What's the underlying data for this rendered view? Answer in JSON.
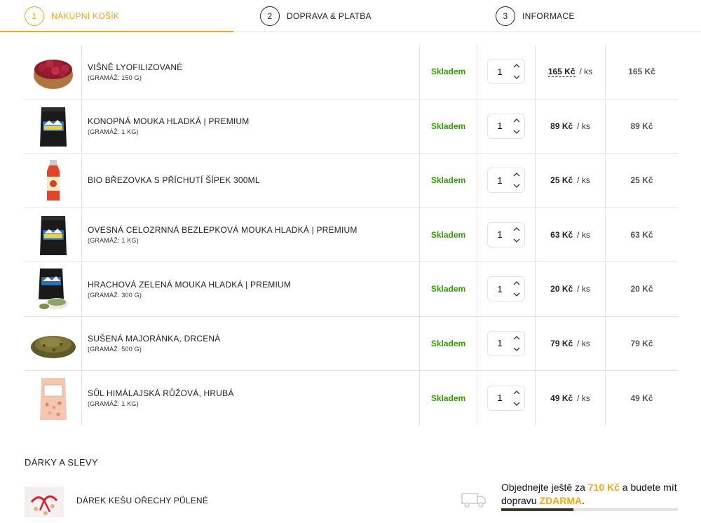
{
  "steps": [
    {
      "num": "1",
      "label": "NÁKUPNÍ KOŠÍK",
      "active": true
    },
    {
      "num": "2",
      "label": "DOPRAVA & PLATBA",
      "active": false
    },
    {
      "num": "3",
      "label": "INFORMACE",
      "active": false
    }
  ],
  "cart": {
    "items": [
      {
        "name": "VIŠNĚ LYOFILIZOVANÉ",
        "variant": "(GRAMÁŽ: 150 G)",
        "stock": "Skladem",
        "qty": "1",
        "price": "165 Kč",
        "unit": "/ ks",
        "total": "165 Kč",
        "image": "cherries-bowl"
      },
      {
        "name": "KONOPNÁ MOUKA HLADKÁ | PREMIUM",
        "variant": "(GRAMÁŽ: 1 KG)",
        "stock": "Skladem",
        "qty": "1",
        "price": "89 Kč",
        "unit": "/ ks",
        "total": "89 Kč",
        "image": "black-bag"
      },
      {
        "name": "BIO BŘEZOVKA S PŘÍCHUTÍ ŠÍPEK 300ML",
        "variant": "",
        "stock": "Skladem",
        "qty": "1",
        "price": "25 Kč",
        "unit": "/ ks",
        "total": "25 Kč",
        "image": "juice-bottle"
      },
      {
        "name": "OVESNÁ CELOZRNNÁ BEZLEPKOVÁ MOUKA HLADKÁ | PREMIUM",
        "variant": "(GRAMÁŽ: 1 KG)",
        "stock": "Skladem",
        "qty": "1",
        "price": "63 Kč",
        "unit": "/ ks",
        "total": "63 Kč",
        "image": "black-bag"
      },
      {
        "name": "HRACHOVÁ ZELENÁ MOUKA HLADKÁ | PREMIUM",
        "variant": "(GRAMÁŽ: 300 G)",
        "stock": "Skladem",
        "qty": "1",
        "price": "20 Kč",
        "unit": "/ ks",
        "total": "20 Kč",
        "image": "small-bag"
      },
      {
        "name": "SUŠENÁ MAJORÁNKA, DRCENÁ",
        "variant": "(GRAMÁŽ: 500 G)",
        "stock": "Skladem",
        "qty": "1",
        "price": "79 Kč",
        "unit": "/ ks",
        "total": "79 Kč",
        "image": "herb-pile"
      },
      {
        "name": "SŮL HIMÁLAJSKÁ RŮŽOVÁ, HRUBÁ",
        "variant": "(GRAMÁŽ: 1 KG)",
        "stock": "Skladem",
        "qty": "1",
        "price": "49 Kč",
        "unit": "/ ks",
        "total": "49 Kč",
        "image": "salt-bag"
      }
    ]
  },
  "gifts": {
    "title": "DÁRKY A SLEVY",
    "item_name": "DÁREK KEŠU OŘECHY PŮLENÉ"
  },
  "shipping": {
    "text_before": "Objednejte ještě za ",
    "amount": "710 Kč",
    "text_middle": " a budete mít dopravu ",
    "free_label": "ZDARMA",
    "text_after": ".",
    "progress_fraction": 0.41
  },
  "colors": {
    "accent": "#f0a81c",
    "stock_green": "#3a9a0a"
  }
}
